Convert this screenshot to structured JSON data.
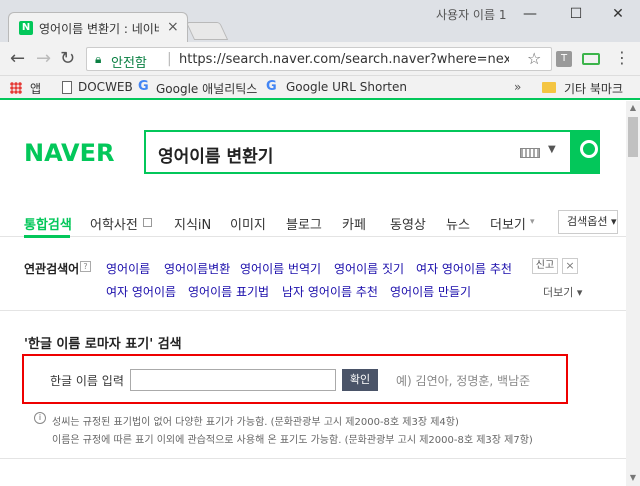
{
  "browser": {
    "tab_title": "영어이름 변환기 : 네이버",
    "tab_close": "×",
    "profile_name": "사용자 이름 1",
    "window_controls": [
      "—",
      "☐",
      "✕"
    ],
    "secure_label": "안전함",
    "url": "https://search.naver.com/search.naver?where=nexearch&s...",
    "bookmarks": {
      "apps": "앱",
      "docweb": "DOCWEB",
      "google_analytics": "Google 애널리틱스",
      "google_url": "Google URL Shorten",
      "other": "기타 북마크"
    },
    "ext1_label": "T"
  },
  "page": {
    "logo": "NAVER",
    "search_query": "영어이름 변환기",
    "tabs": [
      "통합검색",
      "어학사전",
      "지식iN",
      "이미지",
      "블로그",
      "카페",
      "동영상",
      "뉴스",
      "더보기"
    ],
    "search_options": "검색옵션",
    "related": {
      "title": "연관검색어",
      "help": "?",
      "row1": [
        "영어이름",
        "영어이름변환",
        "영어이름 번역기",
        "영어이름 짓기",
        "여자 영어이름 추천"
      ],
      "row2": [
        "여자 영어이름",
        "영어이름 표기법",
        "남자 영어이름 추천",
        "영어이름 만들기"
      ],
      "report": "신고",
      "more": "더보기"
    },
    "converter": {
      "title": "'한글 이름 로마자 표기' 검색",
      "label": "한글 이름 입력",
      "input_value": "",
      "button": "확인",
      "example": "예) 김연아, 정명훈, 백남준"
    },
    "info": {
      "line1": "성씨는 규정된 표기법이 없어 다양한 표기가 가능함. (문화관광부 고시 제2000-8호 제3장 제4항)",
      "line2": "이름은 규정에 따른 표기 이외에 관습적으로 사용해 온 표기도 가능함. (문화관광부 고시 제2000-8호 제3장 제7항)"
    }
  }
}
